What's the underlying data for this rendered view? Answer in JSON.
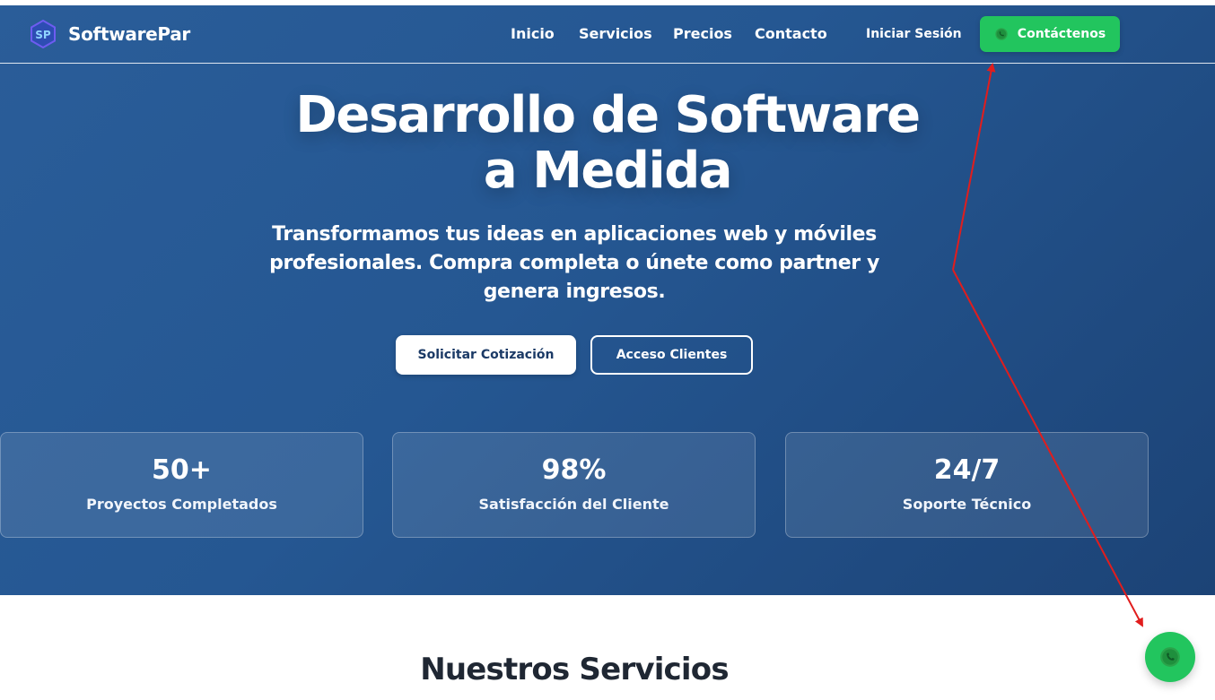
{
  "brand": {
    "logo_text": "SP",
    "name": "SoftwarePar"
  },
  "nav": {
    "links": [
      "Inicio",
      "Servicios",
      "Precios",
      "Contacto"
    ],
    "login": "Iniciar Sesión",
    "contact_button": "Contáctenos"
  },
  "hero": {
    "title_line1": "Desarrollo de Software",
    "title_line2": "a Medida",
    "subtitle_line1": "Transformamos tus ideas en aplicaciones web y móviles",
    "subtitle_line2": "profesionales. Compra completa o únete como partner y",
    "subtitle_line3": "genera ingresos.",
    "primary_button": "Solicitar Cotización",
    "secondary_button": "Acceso Clientes"
  },
  "stats": [
    {
      "value": "50+",
      "label": "Proyectos Completados"
    },
    {
      "value": "98%",
      "label": "Satisfacción del Cliente"
    },
    {
      "value": "24/7",
      "label": "Soporte Técnico"
    }
  ],
  "services": {
    "title": "Nuestros Servicios"
  },
  "floating_button": {
    "icon": "whatsapp-icon"
  },
  "icons": {
    "brand": "softwarepar-logo-icon",
    "contact": "whatsapp-icon"
  },
  "colors": {
    "hero_bg": "#255792",
    "accent_green": "#22c55e",
    "annotation_red": "#e11d1d",
    "title_dark": "#1f2733"
  }
}
